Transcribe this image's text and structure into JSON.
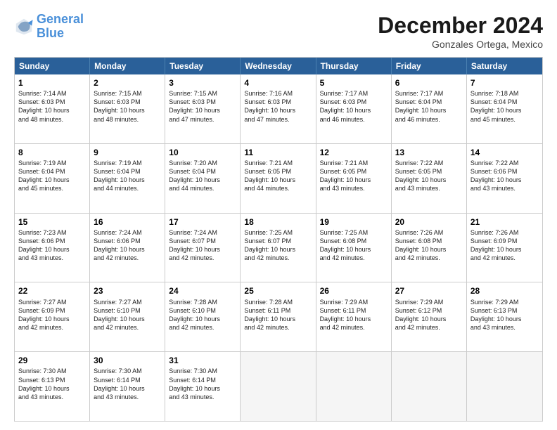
{
  "header": {
    "logo_line1": "General",
    "logo_line2": "Blue",
    "month": "December 2024",
    "location": "Gonzales Ortega, Mexico"
  },
  "weekdays": [
    "Sunday",
    "Monday",
    "Tuesday",
    "Wednesday",
    "Thursday",
    "Friday",
    "Saturday"
  ],
  "rows": [
    [
      {
        "day": "1",
        "lines": [
          "Sunrise: 7:14 AM",
          "Sunset: 6:03 PM",
          "Daylight: 10 hours",
          "and 48 minutes."
        ]
      },
      {
        "day": "2",
        "lines": [
          "Sunrise: 7:15 AM",
          "Sunset: 6:03 PM",
          "Daylight: 10 hours",
          "and 48 minutes."
        ]
      },
      {
        "day": "3",
        "lines": [
          "Sunrise: 7:15 AM",
          "Sunset: 6:03 PM",
          "Daylight: 10 hours",
          "and 47 minutes."
        ]
      },
      {
        "day": "4",
        "lines": [
          "Sunrise: 7:16 AM",
          "Sunset: 6:03 PM",
          "Daylight: 10 hours",
          "and 47 minutes."
        ]
      },
      {
        "day": "5",
        "lines": [
          "Sunrise: 7:17 AM",
          "Sunset: 6:03 PM",
          "Daylight: 10 hours",
          "and 46 minutes."
        ]
      },
      {
        "day": "6",
        "lines": [
          "Sunrise: 7:17 AM",
          "Sunset: 6:04 PM",
          "Daylight: 10 hours",
          "and 46 minutes."
        ]
      },
      {
        "day": "7",
        "lines": [
          "Sunrise: 7:18 AM",
          "Sunset: 6:04 PM",
          "Daylight: 10 hours",
          "and 45 minutes."
        ]
      }
    ],
    [
      {
        "day": "8",
        "lines": [
          "Sunrise: 7:19 AM",
          "Sunset: 6:04 PM",
          "Daylight: 10 hours",
          "and 45 minutes."
        ]
      },
      {
        "day": "9",
        "lines": [
          "Sunrise: 7:19 AM",
          "Sunset: 6:04 PM",
          "Daylight: 10 hours",
          "and 44 minutes."
        ]
      },
      {
        "day": "10",
        "lines": [
          "Sunrise: 7:20 AM",
          "Sunset: 6:04 PM",
          "Daylight: 10 hours",
          "and 44 minutes."
        ]
      },
      {
        "day": "11",
        "lines": [
          "Sunrise: 7:21 AM",
          "Sunset: 6:05 PM",
          "Daylight: 10 hours",
          "and 44 minutes."
        ]
      },
      {
        "day": "12",
        "lines": [
          "Sunrise: 7:21 AM",
          "Sunset: 6:05 PM",
          "Daylight: 10 hours",
          "and 43 minutes."
        ]
      },
      {
        "day": "13",
        "lines": [
          "Sunrise: 7:22 AM",
          "Sunset: 6:05 PM",
          "Daylight: 10 hours",
          "and 43 minutes."
        ]
      },
      {
        "day": "14",
        "lines": [
          "Sunrise: 7:22 AM",
          "Sunset: 6:06 PM",
          "Daylight: 10 hours",
          "and 43 minutes."
        ]
      }
    ],
    [
      {
        "day": "15",
        "lines": [
          "Sunrise: 7:23 AM",
          "Sunset: 6:06 PM",
          "Daylight: 10 hours",
          "and 43 minutes."
        ]
      },
      {
        "day": "16",
        "lines": [
          "Sunrise: 7:24 AM",
          "Sunset: 6:06 PM",
          "Daylight: 10 hours",
          "and 42 minutes."
        ]
      },
      {
        "day": "17",
        "lines": [
          "Sunrise: 7:24 AM",
          "Sunset: 6:07 PM",
          "Daylight: 10 hours",
          "and 42 minutes."
        ]
      },
      {
        "day": "18",
        "lines": [
          "Sunrise: 7:25 AM",
          "Sunset: 6:07 PM",
          "Daylight: 10 hours",
          "and 42 minutes."
        ]
      },
      {
        "day": "19",
        "lines": [
          "Sunrise: 7:25 AM",
          "Sunset: 6:08 PM",
          "Daylight: 10 hours",
          "and 42 minutes."
        ]
      },
      {
        "day": "20",
        "lines": [
          "Sunrise: 7:26 AM",
          "Sunset: 6:08 PM",
          "Daylight: 10 hours",
          "and 42 minutes."
        ]
      },
      {
        "day": "21",
        "lines": [
          "Sunrise: 7:26 AM",
          "Sunset: 6:09 PM",
          "Daylight: 10 hours",
          "and 42 minutes."
        ]
      }
    ],
    [
      {
        "day": "22",
        "lines": [
          "Sunrise: 7:27 AM",
          "Sunset: 6:09 PM",
          "Daylight: 10 hours",
          "and 42 minutes."
        ]
      },
      {
        "day": "23",
        "lines": [
          "Sunrise: 7:27 AM",
          "Sunset: 6:10 PM",
          "Daylight: 10 hours",
          "and 42 minutes."
        ]
      },
      {
        "day": "24",
        "lines": [
          "Sunrise: 7:28 AM",
          "Sunset: 6:10 PM",
          "Daylight: 10 hours",
          "and 42 minutes."
        ]
      },
      {
        "day": "25",
        "lines": [
          "Sunrise: 7:28 AM",
          "Sunset: 6:11 PM",
          "Daylight: 10 hours",
          "and 42 minutes."
        ]
      },
      {
        "day": "26",
        "lines": [
          "Sunrise: 7:29 AM",
          "Sunset: 6:11 PM",
          "Daylight: 10 hours",
          "and 42 minutes."
        ]
      },
      {
        "day": "27",
        "lines": [
          "Sunrise: 7:29 AM",
          "Sunset: 6:12 PM",
          "Daylight: 10 hours",
          "and 42 minutes."
        ]
      },
      {
        "day": "28",
        "lines": [
          "Sunrise: 7:29 AM",
          "Sunset: 6:13 PM",
          "Daylight: 10 hours",
          "and 43 minutes."
        ]
      }
    ],
    [
      {
        "day": "29",
        "lines": [
          "Sunrise: 7:30 AM",
          "Sunset: 6:13 PM",
          "Daylight: 10 hours",
          "and 43 minutes."
        ]
      },
      {
        "day": "30",
        "lines": [
          "Sunrise: 7:30 AM",
          "Sunset: 6:14 PM",
          "Daylight: 10 hours",
          "and 43 minutes."
        ]
      },
      {
        "day": "31",
        "lines": [
          "Sunrise: 7:30 AM",
          "Sunset: 6:14 PM",
          "Daylight: 10 hours",
          "and 43 minutes."
        ]
      },
      null,
      null,
      null,
      null
    ]
  ]
}
